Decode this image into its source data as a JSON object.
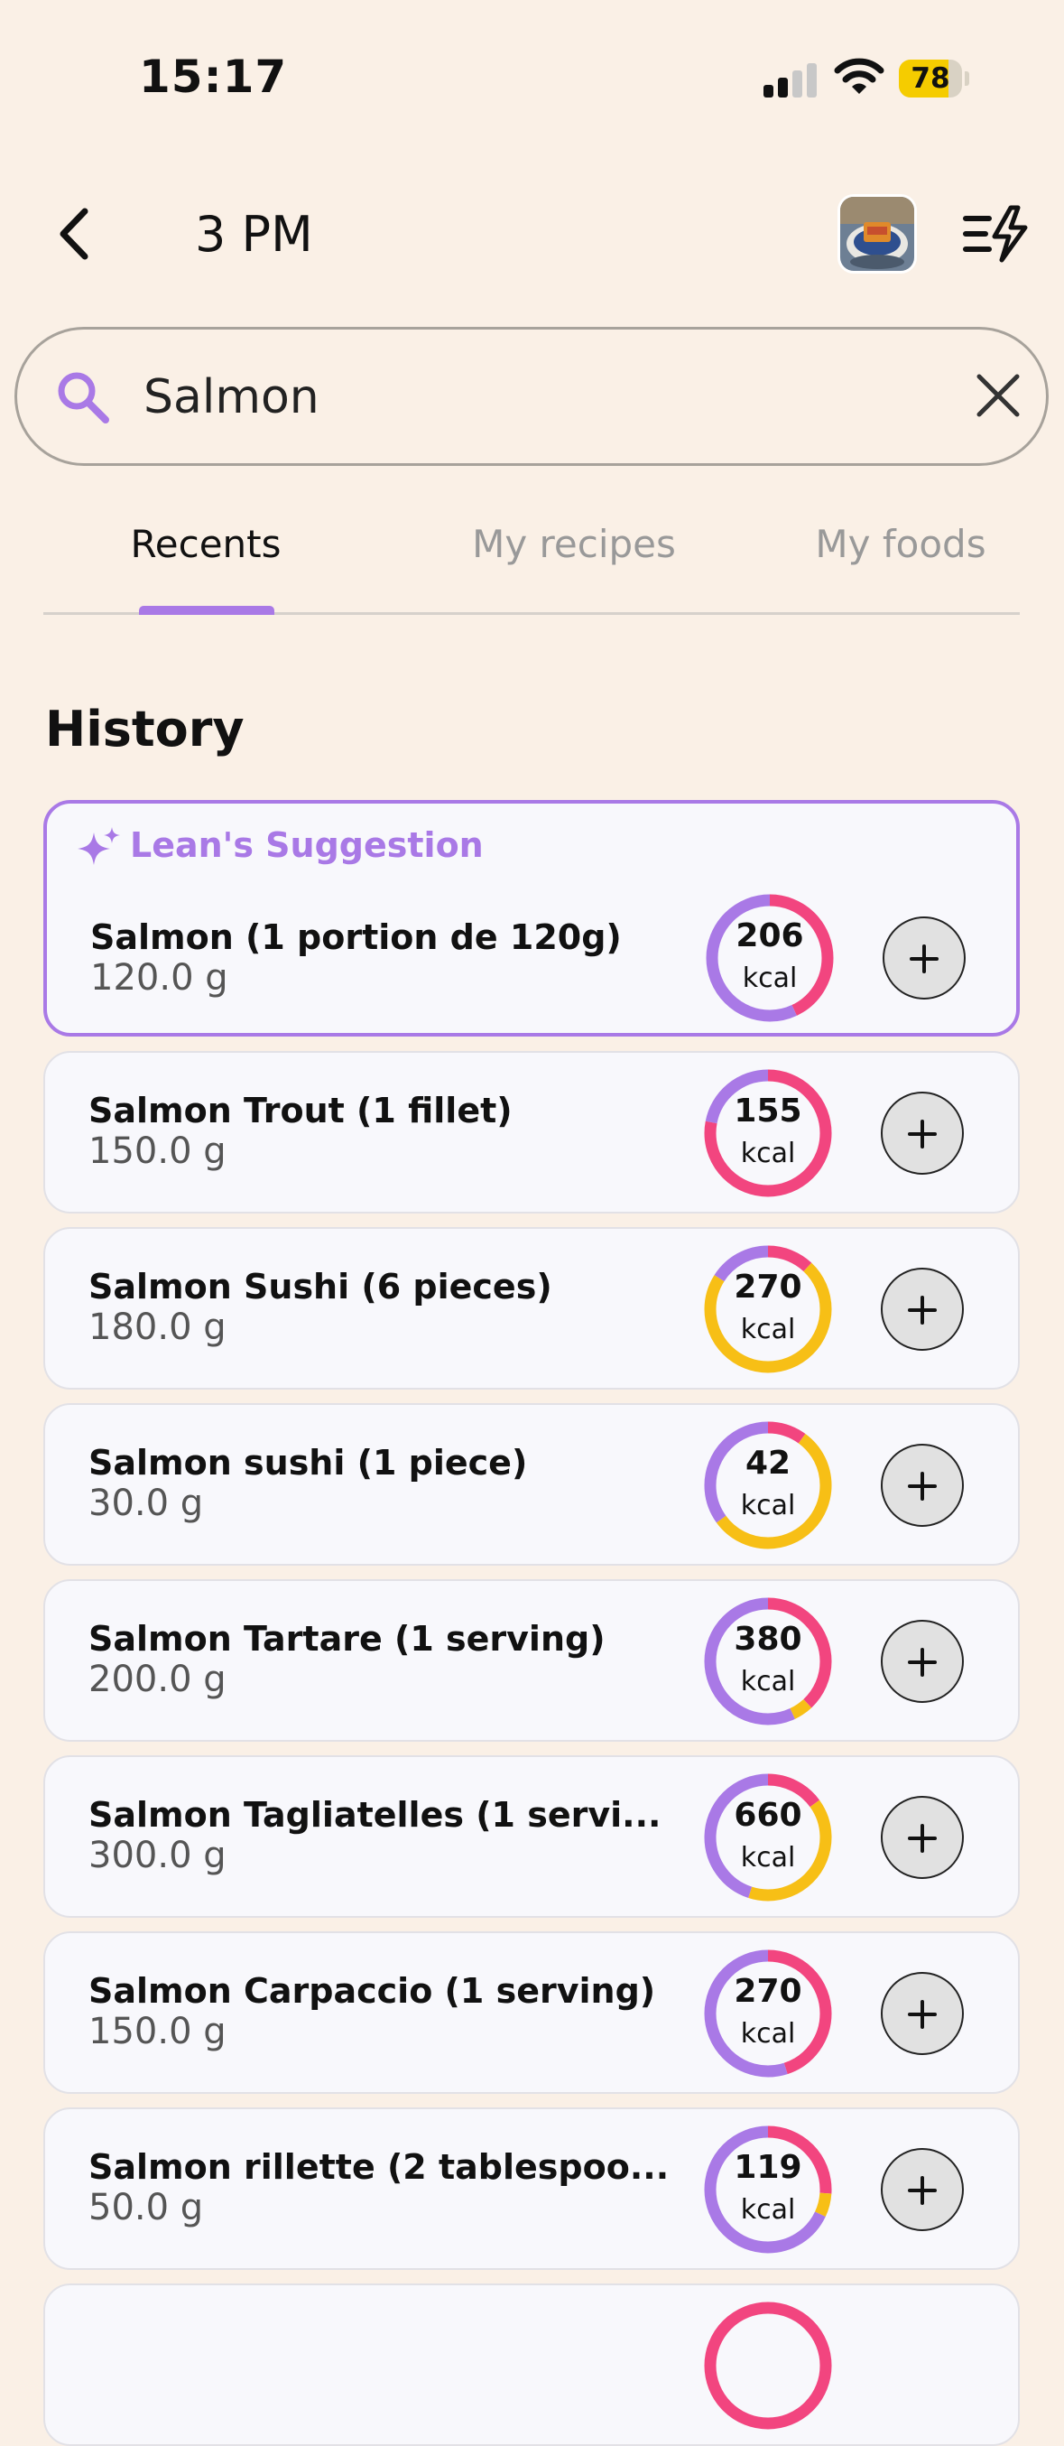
{
  "status": {
    "time": "15:17",
    "battery": "78",
    "battery_level": 0.78
  },
  "header": {
    "title": "3 PM",
    "back_icon": "chevron-left-icon",
    "quick_add_icon": "lines-bolt-icon"
  },
  "search": {
    "value": "Salmon",
    "placeholder": ""
  },
  "tabs": [
    {
      "label": "Recents",
      "active": true
    },
    {
      "label": "My recipes",
      "active": false
    },
    {
      "label": "My foods",
      "active": false
    }
  ],
  "history": {
    "title": "History",
    "suggestion_label": "Lean's Suggestion",
    "items": [
      {
        "name": "Salmon (1 portion de 120g)",
        "qty": "120.0 g",
        "kcal": "206",
        "unit": "kcal",
        "segments": [
          {
            "color": "#f2457f",
            "frac": 0.43
          },
          {
            "color": "#a979e6",
            "frac": 0.57
          }
        ]
      },
      {
        "name": "Salmon Trout (1 fillet)",
        "qty": "150.0 g",
        "kcal": "155",
        "unit": "kcal",
        "segments": [
          {
            "color": "#f2457f",
            "frac": 0.78
          },
          {
            "color": "#a979e6",
            "frac": 0.22
          }
        ]
      },
      {
        "name": "Salmon Sushi (6 pieces)",
        "qty": "180.0 g",
        "kcal": "270",
        "unit": "kcal",
        "segments": [
          {
            "color": "#f2457f",
            "frac": 0.12
          },
          {
            "color": "#f7bf16",
            "frac": 0.72
          },
          {
            "color": "#a979e6",
            "frac": 0.16
          }
        ]
      },
      {
        "name": "Salmon sushi (1 piece)",
        "qty": "30.0 g",
        "kcal": "42",
        "unit": "kcal",
        "segments": [
          {
            "color": "#f2457f",
            "frac": 0.1
          },
          {
            "color": "#f7bf16",
            "frac": 0.55
          },
          {
            "color": "#a979e6",
            "frac": 0.35
          }
        ]
      },
      {
        "name": "Salmon Tartare (1 serving)",
        "qty": "200.0 g",
        "kcal": "380",
        "unit": "kcal",
        "segments": [
          {
            "color": "#f2457f",
            "frac": 0.38
          },
          {
            "color": "#f7bf16",
            "frac": 0.05
          },
          {
            "color": "#a979e6",
            "frac": 0.57
          }
        ]
      },
      {
        "name": "Salmon Tagliatelles (1 servi...",
        "qty": "300.0 g",
        "kcal": "660",
        "unit": "kcal",
        "segments": [
          {
            "color": "#f2457f",
            "frac": 0.15
          },
          {
            "color": "#f7bf16",
            "frac": 0.4
          },
          {
            "color": "#a979e6",
            "frac": 0.45
          }
        ]
      },
      {
        "name": "Salmon Carpaccio (1 serving)",
        "qty": "150.0 g",
        "kcal": "270",
        "unit": "kcal",
        "segments": [
          {
            "color": "#f2457f",
            "frac": 0.45
          },
          {
            "color": "#a979e6",
            "frac": 0.55
          }
        ]
      },
      {
        "name": "Salmon rillette (2 tablespoo...",
        "qty": "50.0 g",
        "kcal": "119",
        "unit": "kcal",
        "segments": [
          {
            "color": "#f2457f",
            "frac": 0.26
          },
          {
            "color": "#f7bf16",
            "frac": 0.06
          },
          {
            "color": "#a979e6",
            "frac": 0.68
          }
        ]
      }
    ]
  },
  "colors": {
    "accent": "#a979e6",
    "protein": "#f2457f",
    "carbs": "#f7bf16",
    "fat": "#a979e6",
    "background": "#faf0e6"
  }
}
